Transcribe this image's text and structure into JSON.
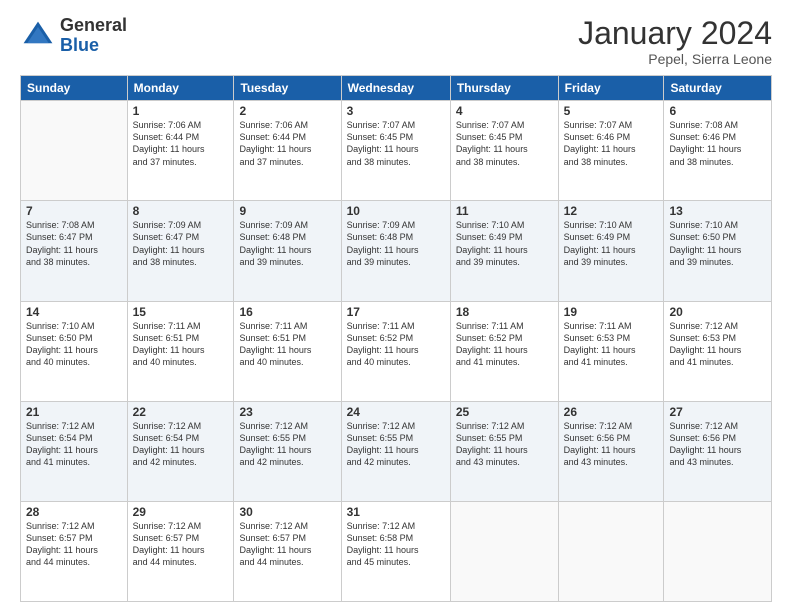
{
  "logo": {
    "general": "General",
    "blue": "Blue"
  },
  "header": {
    "month": "January 2024",
    "location": "Pepel, Sierra Leone"
  },
  "days": [
    "Sunday",
    "Monday",
    "Tuesday",
    "Wednesday",
    "Thursday",
    "Friday",
    "Saturday"
  ],
  "weeks": [
    [
      {
        "day": "",
        "info": ""
      },
      {
        "day": "1",
        "info": "Sunrise: 7:06 AM\nSunset: 6:44 PM\nDaylight: 11 hours\nand 37 minutes."
      },
      {
        "day": "2",
        "info": "Sunrise: 7:06 AM\nSunset: 6:44 PM\nDaylight: 11 hours\nand 37 minutes."
      },
      {
        "day": "3",
        "info": "Sunrise: 7:07 AM\nSunset: 6:45 PM\nDaylight: 11 hours\nand 38 minutes."
      },
      {
        "day": "4",
        "info": "Sunrise: 7:07 AM\nSunset: 6:45 PM\nDaylight: 11 hours\nand 38 minutes."
      },
      {
        "day": "5",
        "info": "Sunrise: 7:07 AM\nSunset: 6:46 PM\nDaylight: 11 hours\nand 38 minutes."
      },
      {
        "day": "6",
        "info": "Sunrise: 7:08 AM\nSunset: 6:46 PM\nDaylight: 11 hours\nand 38 minutes."
      }
    ],
    [
      {
        "day": "7",
        "info": "Sunrise: 7:08 AM\nSunset: 6:47 PM\nDaylight: 11 hours\nand 38 minutes."
      },
      {
        "day": "8",
        "info": "Sunrise: 7:09 AM\nSunset: 6:47 PM\nDaylight: 11 hours\nand 38 minutes."
      },
      {
        "day": "9",
        "info": "Sunrise: 7:09 AM\nSunset: 6:48 PM\nDaylight: 11 hours\nand 39 minutes."
      },
      {
        "day": "10",
        "info": "Sunrise: 7:09 AM\nSunset: 6:48 PM\nDaylight: 11 hours\nand 39 minutes."
      },
      {
        "day": "11",
        "info": "Sunrise: 7:10 AM\nSunset: 6:49 PM\nDaylight: 11 hours\nand 39 minutes."
      },
      {
        "day": "12",
        "info": "Sunrise: 7:10 AM\nSunset: 6:49 PM\nDaylight: 11 hours\nand 39 minutes."
      },
      {
        "day": "13",
        "info": "Sunrise: 7:10 AM\nSunset: 6:50 PM\nDaylight: 11 hours\nand 39 minutes."
      }
    ],
    [
      {
        "day": "14",
        "info": "Sunrise: 7:10 AM\nSunset: 6:50 PM\nDaylight: 11 hours\nand 40 minutes."
      },
      {
        "day": "15",
        "info": "Sunrise: 7:11 AM\nSunset: 6:51 PM\nDaylight: 11 hours\nand 40 minutes."
      },
      {
        "day": "16",
        "info": "Sunrise: 7:11 AM\nSunset: 6:51 PM\nDaylight: 11 hours\nand 40 minutes."
      },
      {
        "day": "17",
        "info": "Sunrise: 7:11 AM\nSunset: 6:52 PM\nDaylight: 11 hours\nand 40 minutes."
      },
      {
        "day": "18",
        "info": "Sunrise: 7:11 AM\nSunset: 6:52 PM\nDaylight: 11 hours\nand 41 minutes."
      },
      {
        "day": "19",
        "info": "Sunrise: 7:11 AM\nSunset: 6:53 PM\nDaylight: 11 hours\nand 41 minutes."
      },
      {
        "day": "20",
        "info": "Sunrise: 7:12 AM\nSunset: 6:53 PM\nDaylight: 11 hours\nand 41 minutes."
      }
    ],
    [
      {
        "day": "21",
        "info": "Sunrise: 7:12 AM\nSunset: 6:54 PM\nDaylight: 11 hours\nand 41 minutes."
      },
      {
        "day": "22",
        "info": "Sunrise: 7:12 AM\nSunset: 6:54 PM\nDaylight: 11 hours\nand 42 minutes."
      },
      {
        "day": "23",
        "info": "Sunrise: 7:12 AM\nSunset: 6:55 PM\nDaylight: 11 hours\nand 42 minutes."
      },
      {
        "day": "24",
        "info": "Sunrise: 7:12 AM\nSunset: 6:55 PM\nDaylight: 11 hours\nand 42 minutes."
      },
      {
        "day": "25",
        "info": "Sunrise: 7:12 AM\nSunset: 6:55 PM\nDaylight: 11 hours\nand 43 minutes."
      },
      {
        "day": "26",
        "info": "Sunrise: 7:12 AM\nSunset: 6:56 PM\nDaylight: 11 hours\nand 43 minutes."
      },
      {
        "day": "27",
        "info": "Sunrise: 7:12 AM\nSunset: 6:56 PM\nDaylight: 11 hours\nand 43 minutes."
      }
    ],
    [
      {
        "day": "28",
        "info": "Sunrise: 7:12 AM\nSunset: 6:57 PM\nDaylight: 11 hours\nand 44 minutes."
      },
      {
        "day": "29",
        "info": "Sunrise: 7:12 AM\nSunset: 6:57 PM\nDaylight: 11 hours\nand 44 minutes."
      },
      {
        "day": "30",
        "info": "Sunrise: 7:12 AM\nSunset: 6:57 PM\nDaylight: 11 hours\nand 44 minutes."
      },
      {
        "day": "31",
        "info": "Sunrise: 7:12 AM\nSunset: 6:58 PM\nDaylight: 11 hours\nand 45 minutes."
      },
      {
        "day": "",
        "info": ""
      },
      {
        "day": "",
        "info": ""
      },
      {
        "day": "",
        "info": ""
      }
    ]
  ]
}
